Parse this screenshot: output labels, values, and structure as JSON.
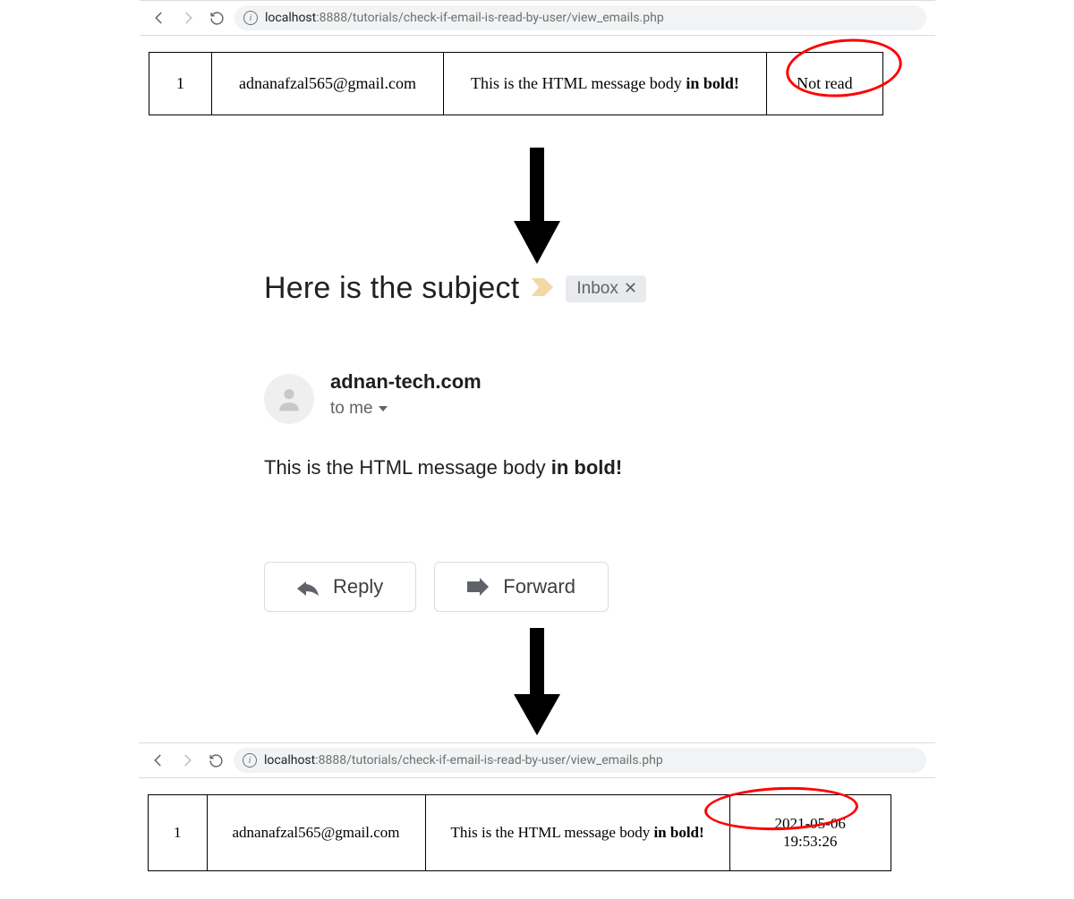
{
  "browser_top": {
    "host": "localhost",
    "port_path": ":8888/tutorials/check-if-email-is-read-by-user/view_emails.php"
  },
  "table_top": {
    "id": "1",
    "email": "adnanafzal565@gmail.com",
    "body_prefix": "This is the HTML message body ",
    "body_bold": "in bold!",
    "status": "Not read"
  },
  "gmail": {
    "subject": "Here is the subject",
    "inbox_label": "Inbox",
    "from": "adnan-tech.com",
    "to_line": "to me",
    "body_prefix": "This is the HTML message body ",
    "body_bold": "in bold!",
    "reply": "Reply",
    "forward": "Forward"
  },
  "browser_bottom": {
    "host": "localhost",
    "port_path": ":8888/tutorials/check-if-email-is-read-by-user/view_emails.php"
  },
  "table_bottom": {
    "id": "1",
    "email": "adnanafzal565@gmail.com",
    "body_prefix": "This is the HTML message body ",
    "body_bold": "in bold!",
    "status": "2021-05-06 19:53:26"
  }
}
